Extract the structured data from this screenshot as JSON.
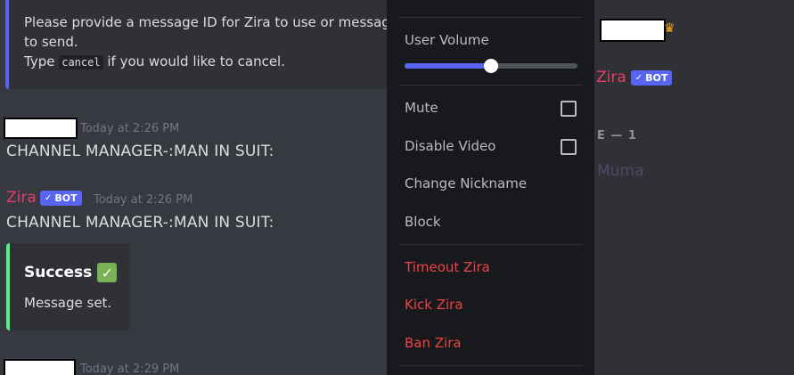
{
  "chat": {
    "prompt_embed": {
      "line1": "Please provide a message ID for Zira to use or message f",
      "line2": "to send.",
      "line3_pre": "Type ",
      "line3_code": "cancel",
      "line3_post": " if you would like to cancel."
    },
    "messages": [
      {
        "timestamp": "Today at 2:26 PM",
        "text": "CHANNEL MANAGER-:MAN IN SUIT:"
      },
      {
        "author": "Zira",
        "bot_tag": "BOT",
        "timestamp": "Today at 2:26 PM",
        "text": "CHANNEL MANAGER-:MAN IN SUIT:",
        "embed": {
          "title": "Success",
          "title_emoji": "✓",
          "description": "Message set."
        }
      },
      {
        "timestamp": "Today at 2:29 PM"
      }
    ]
  },
  "context_menu": {
    "user_volume_label": "User Volume",
    "user_volume_level": 0.5,
    "mute_label": "Mute",
    "disable_video_label": "Disable Video",
    "change_nickname_label": "Change Nickname",
    "block_label": "Block",
    "timeout_label": "Timeout Zira",
    "kick_label": "Kick Zira",
    "ban_label": "Ban Zira"
  },
  "member_list": {
    "crown_icon": "crown-icon",
    "bot_name": "Zira",
    "bot_tag": "BOT",
    "section_header": "E — 1",
    "member_name": "Muma"
  },
  "colors": {
    "accent": "#5865f2",
    "danger": "#ed4245",
    "success": "#57f287",
    "bot_name": "#e63e67"
  }
}
